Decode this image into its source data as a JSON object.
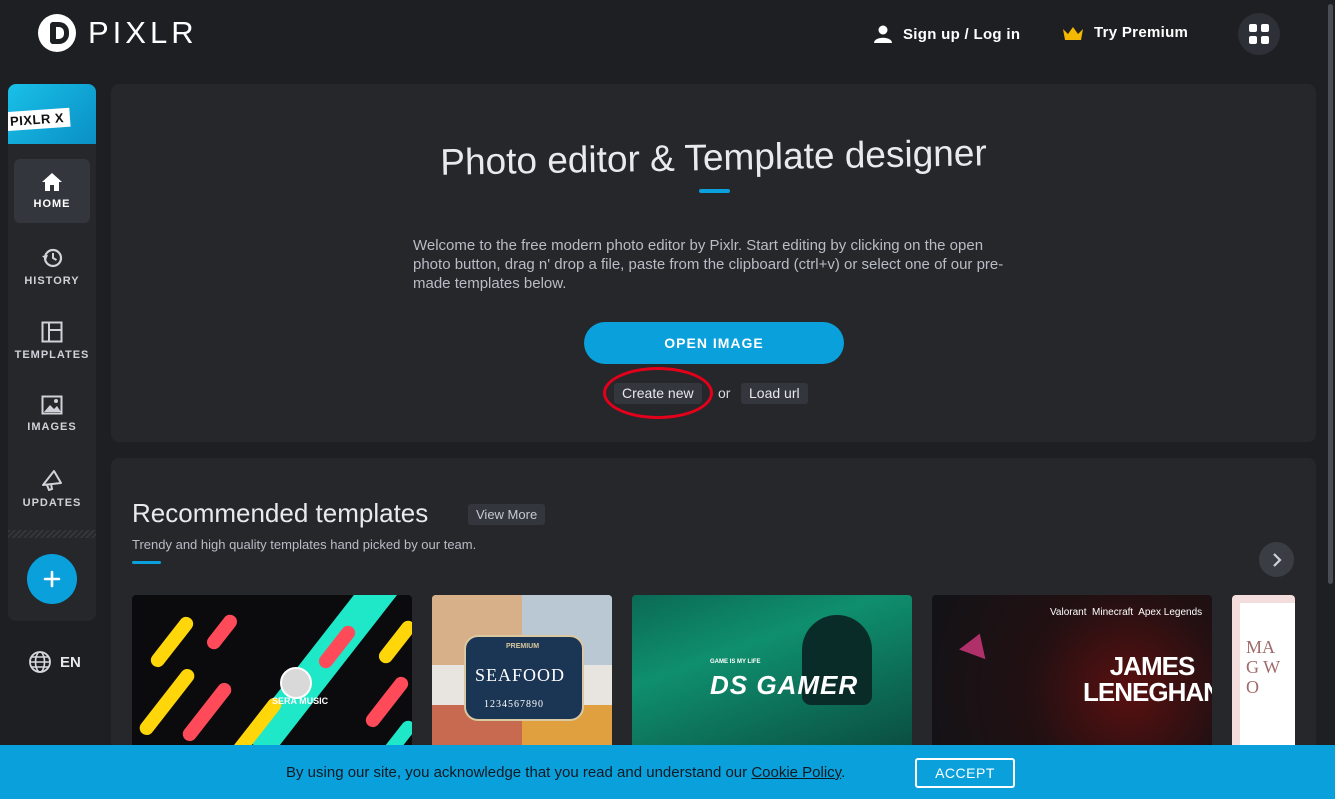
{
  "header": {
    "logo_text": "PIXLR",
    "signup_label": "Sign up / Log in",
    "premium_label": "Try Premium",
    "premium_color": "#f5b800"
  },
  "sidebar": {
    "banner_label": "PIXLR X",
    "items": [
      {
        "label": "HOME",
        "icon": "home-icon",
        "active": true
      },
      {
        "label": "HISTORY",
        "icon": "history-icon"
      },
      {
        "label": "TEMPLATES",
        "icon": "templates-icon"
      },
      {
        "label": "IMAGES",
        "icon": "image-icon"
      },
      {
        "label": "UPDATES",
        "icon": "megaphone-icon"
      }
    ],
    "add_icon": "plus-icon",
    "language": "EN"
  },
  "hero": {
    "title": "Photo editor & Template designer",
    "description": "Welcome to the free modern photo editor by Pixlr. Start editing by clicking on the open photo button, drag n' drop a file, paste from the clipboard (ctrl+v) or select one of our pre-made templates below.",
    "open_button": "OPEN IMAGE",
    "create_new": "Create new",
    "or_text": "or",
    "load_url": "Load url"
  },
  "recommended": {
    "title": "Recommended templates",
    "view_more": "View More",
    "subtitle": "Trendy and high quality templates hand picked by our team.",
    "cards": [
      {
        "name": "SERA MUSIC"
      },
      {
        "name": "SEAFOOD",
        "premium": "PREMIUM",
        "phone": "1234567890"
      },
      {
        "name": "DS GAMER",
        "tagline": "GAME IS MY LIFE"
      },
      {
        "name": "JAMES LENEGHAN",
        "games": "Valorant  Minecraft  Apex Legends"
      },
      {
        "name": "MAG WO"
      }
    ]
  },
  "cookie": {
    "text": "By using our site, you acknowledge that you read and understand our",
    "link": "Cookie Policy",
    "accept": "ACCEPT"
  },
  "colors": {
    "accent": "#0aa0dc",
    "background": "#1d1f23",
    "panel": "#25272b",
    "annotation": "#e4001b"
  }
}
